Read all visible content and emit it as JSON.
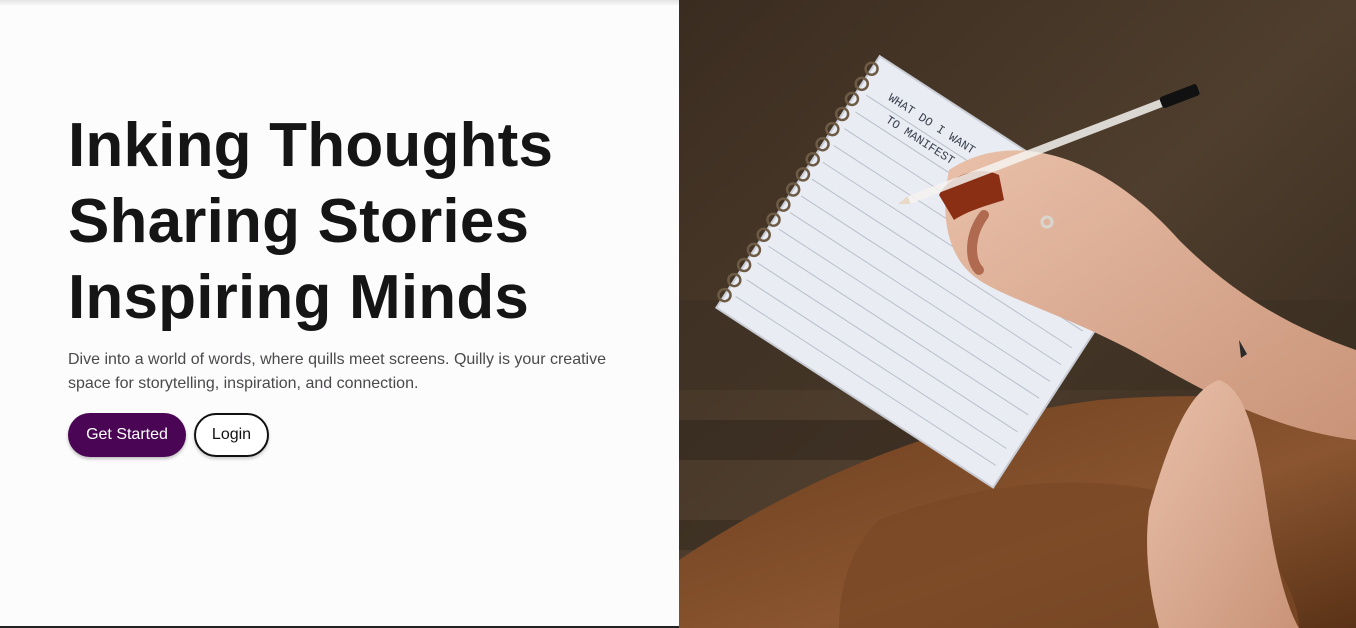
{
  "hero": {
    "headline_lines": [
      "Inking Thoughts",
      "Sharing Stories",
      "Inspiring Minds"
    ],
    "description": "Dive into a world of words, where quills meet screens. Quilly is your creative space for storytelling, inspiration, and connection.",
    "primary_button": "Get Started",
    "secondary_button": "Login"
  },
  "image": {
    "notebook_text_line1": "WHAT DO I WANT",
    "notebook_text_line2": "TO MANIFEST FOR MYSELF?"
  },
  "colors": {
    "primary_button_bg": "#4a0654",
    "headline": "#151515",
    "body_text": "#4a4a4a"
  }
}
